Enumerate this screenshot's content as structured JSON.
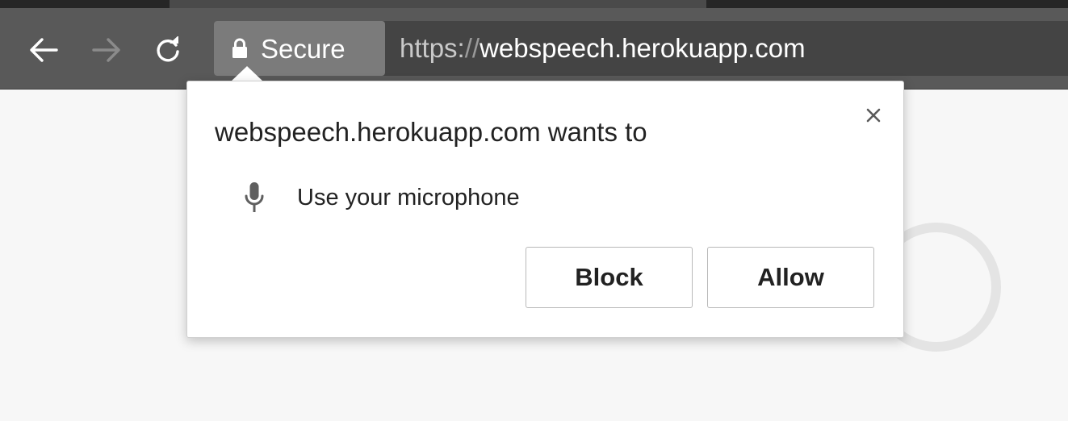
{
  "toolbar": {
    "back_icon": "arrow-left-icon",
    "forward_icon": "arrow-right-icon",
    "reload_icon": "reload-icon",
    "omnibox": {
      "security_icon": "lock-icon",
      "security_label": "Secure",
      "url_scheme": "https:",
      "url_separator": "//",
      "url_host": "webspeech.herokuapp.com"
    }
  },
  "permission_prompt": {
    "title": "webspeech.herokuapp.com wants to",
    "close_icon": "close-icon",
    "permission": {
      "icon": "microphone-icon",
      "label": "Use your microphone"
    },
    "buttons": {
      "block_label": "Block",
      "allow_label": "Allow"
    }
  },
  "colors": {
    "toolbar_bg": "#595959",
    "omnibox_bg": "#444444",
    "secure_chip_bg": "#7b7b7b",
    "page_bg": "#f7f7f7",
    "bubble_bg": "#ffffff",
    "text": "#222222"
  }
}
